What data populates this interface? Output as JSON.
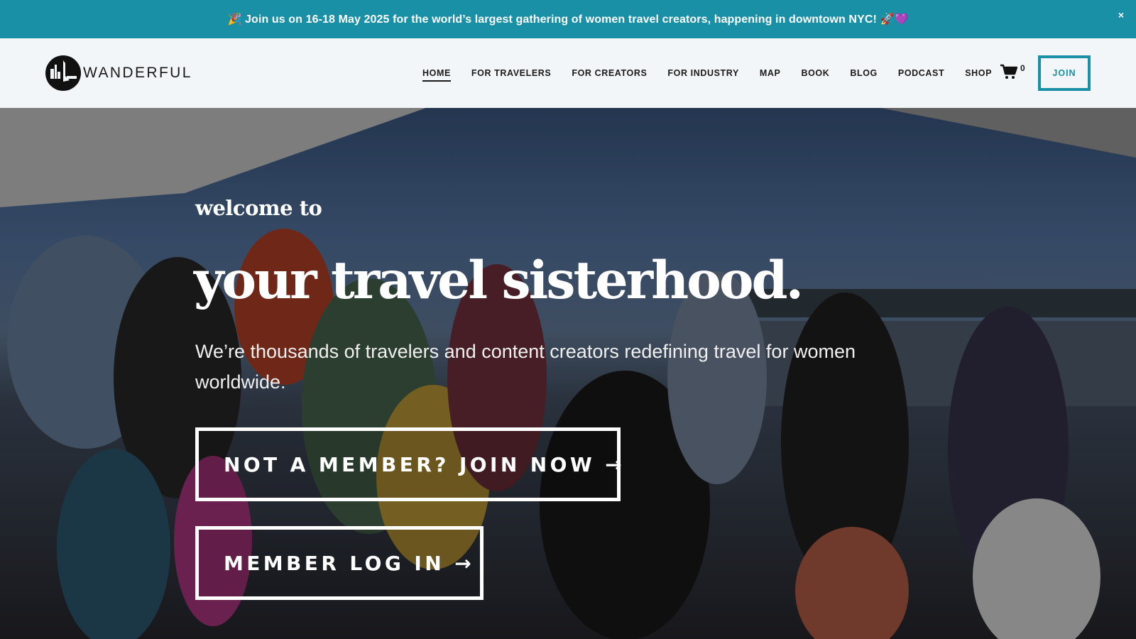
{
  "announcement": {
    "text": "🎉 Join us on 16-18 May 2025 for the world’s largest gathering of women travel creators, happening in downtown NYC! 🚀💜",
    "close_icon": "close-icon",
    "close_glyph": "×"
  },
  "header": {
    "logo_text": "WANDERFUL",
    "logo_icon": "city-skyline-circle-logo",
    "nav": [
      {
        "label": "HOME",
        "active": true
      },
      {
        "label": "FOR TRAVELERS"
      },
      {
        "label": "FOR CREATORS"
      },
      {
        "label": "FOR INDUSTRY"
      },
      {
        "label": "MAP"
      },
      {
        "label": "BOOK"
      },
      {
        "label": "BLOG"
      },
      {
        "label": "PODCAST"
      },
      {
        "label": "SHOP"
      }
    ],
    "cart_icon": "shopping-cart-icon",
    "cart_count": "0",
    "join_label": "JOIN"
  },
  "hero": {
    "welcome": "welcome to",
    "headline_part1": "your travel ",
    "headline_accent": "sisterhood",
    "headline_dot": ".",
    "subtext": "We’re thousands of travelers and content creators redefining travel for women worldwide.",
    "cta_join": "NOT A MEMBER? JOIN NOW →",
    "cta_login": "MEMBER LOG IN →"
  },
  "colors": {
    "accent": "#1990a6",
    "header_bg": "#f3f6f9",
    "text_dark": "#1a1a1a"
  }
}
